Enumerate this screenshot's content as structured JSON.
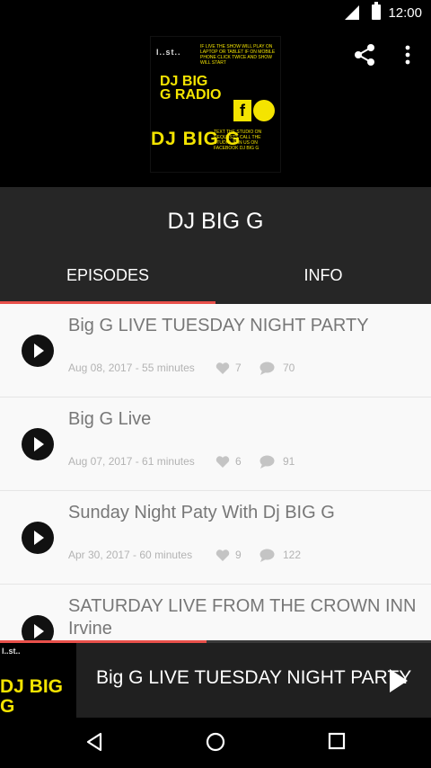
{
  "status_bar": {
    "time": "12:00"
  },
  "cover": {
    "top_mark": "I..st..",
    "title_line": "DJ BIG G RADIO",
    "big_text": "DJ BIG G",
    "fb_letter": "f",
    "promo_text": "IF LIVE THE SHOW WILL PLAY ON LAPTOP OR TABLET IF ON MOBILE PHONE CLICK TWICE AND SHOW WILL START",
    "promo_text_2": "TEXT THE STUDIO ON REQUESTS CALL THE STUDIO JOIN US ON FACEBOOK DJ BIG G"
  },
  "header": {
    "title": "DJ BIG G"
  },
  "tabs": [
    {
      "label": "EPISODES"
    },
    {
      "label": "INFO"
    }
  ],
  "episodes": [
    {
      "title": "Big G LIVE TUESDAY NIGHT PARTY",
      "meta": "Aug 08, 2017 - 55 minutes",
      "likes": "7",
      "comments": "70"
    },
    {
      "title": "Big G Live",
      "meta": "Aug 07, 2017 - 61 minutes",
      "likes": "6",
      "comments": "91"
    },
    {
      "title": "Sunday Night Paty With Dj BIG G",
      "meta": "Apr 30, 2017 - 60 minutes",
      "likes": "9",
      "comments": "122"
    },
    {
      "title": "SATURDAY LIVE FROM THE CROWN INN Irvine",
      "meta": "",
      "likes": "",
      "comments": ""
    }
  ],
  "player": {
    "title": "Big G LIVE TUESDAY NIGHT PARTY",
    "progress_fraction": 0.48,
    "thumb_mark": "I..st..",
    "thumb_text": "DJ BIG G RADIO"
  },
  "colors": {
    "accent": "#e8504a",
    "header_bg": "#262626",
    "player_bg": "#202020",
    "logo_yellow": "#f4e400"
  },
  "icons": [
    "share-icon",
    "more-vert-icon",
    "play-icon",
    "heart-icon",
    "comment-icon",
    "back-icon",
    "home-icon",
    "recents-icon",
    "signal-icon",
    "battery-icon"
  ]
}
